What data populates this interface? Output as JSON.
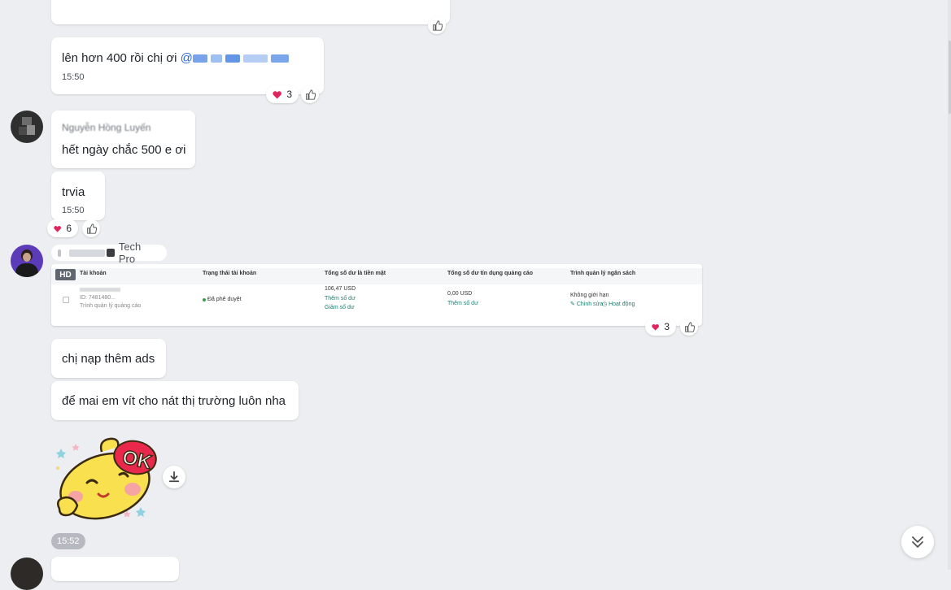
{
  "messages": {
    "m1": {
      "text": "lên hơn 400 rồi chị ơi",
      "mention": "@",
      "time": "15:50"
    },
    "m1_reaction": {
      "count": "3"
    },
    "m2": {
      "sender": "Nguyễn Hồng Luyến",
      "text": "hết ngày chắc 500 e ơi"
    },
    "m3": {
      "text": "trvia",
      "time": "15:50"
    },
    "m3_reaction": {
      "count": "6"
    },
    "m4": {
      "sender_suffix": "Tech Pro"
    },
    "m4_reaction": {
      "count": "3"
    },
    "m5": {
      "text": "chị nạp thêm ads"
    },
    "m6": {
      "text": "để mai em vít cho nát thị trường luôn nha"
    },
    "sticker_time": "15:52"
  },
  "shot": {
    "badge": "HD",
    "headers": [
      "Tài khoản",
      "Trạng thái tài khoản",
      "Tổng số dư là tiền mặt",
      "Tổng số dư tín dụng quảng cáo",
      "Trình quản lý ngân sách"
    ],
    "account_id": "ID: 7481480...",
    "account_sub": "Trình quản lý quảng cáo",
    "status": "Đã phê duyệt",
    "cash_value": "106,47 USD",
    "cash_link1": "Thêm số dư",
    "cash_link2": "Giảm số dư",
    "credit_value": "0,00 USD",
    "credit_link": "Thêm số dư",
    "budget_value": "Không giới hạn",
    "budget_edit": "Chỉnh sửa",
    "budget_activity": "Hoạt động"
  },
  "sticker": {
    "label": "OK"
  },
  "colors": {
    "background": "#eceef1",
    "mention": "#2a6ad8",
    "heart": "#e0245e",
    "link": "#1a7d6e"
  },
  "icons": [
    "thumbs-up-icon",
    "heart-icon",
    "download-icon",
    "double-chevron-down-icon"
  ]
}
